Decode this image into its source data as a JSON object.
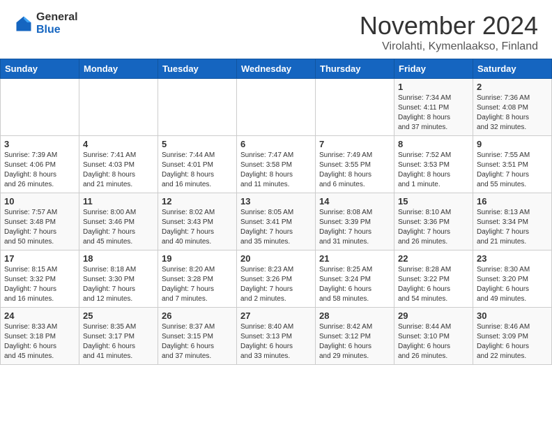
{
  "header": {
    "logo_general": "General",
    "logo_blue": "Blue",
    "month_title": "November 2024",
    "location": "Virolahti, Kymenlaakso, Finland"
  },
  "calendar": {
    "days_of_week": [
      "Sunday",
      "Monday",
      "Tuesday",
      "Wednesday",
      "Thursday",
      "Friday",
      "Saturday"
    ],
    "weeks": [
      [
        {
          "day": "",
          "info": ""
        },
        {
          "day": "",
          "info": ""
        },
        {
          "day": "",
          "info": ""
        },
        {
          "day": "",
          "info": ""
        },
        {
          "day": "",
          "info": ""
        },
        {
          "day": "1",
          "info": "Sunrise: 7:34 AM\nSunset: 4:11 PM\nDaylight: 8 hours\nand 37 minutes."
        },
        {
          "day": "2",
          "info": "Sunrise: 7:36 AM\nSunset: 4:08 PM\nDaylight: 8 hours\nand 32 minutes."
        }
      ],
      [
        {
          "day": "3",
          "info": "Sunrise: 7:39 AM\nSunset: 4:06 PM\nDaylight: 8 hours\nand 26 minutes."
        },
        {
          "day": "4",
          "info": "Sunrise: 7:41 AM\nSunset: 4:03 PM\nDaylight: 8 hours\nand 21 minutes."
        },
        {
          "day": "5",
          "info": "Sunrise: 7:44 AM\nSunset: 4:01 PM\nDaylight: 8 hours\nand 16 minutes."
        },
        {
          "day": "6",
          "info": "Sunrise: 7:47 AM\nSunset: 3:58 PM\nDaylight: 8 hours\nand 11 minutes."
        },
        {
          "day": "7",
          "info": "Sunrise: 7:49 AM\nSunset: 3:55 PM\nDaylight: 8 hours\nand 6 minutes."
        },
        {
          "day": "8",
          "info": "Sunrise: 7:52 AM\nSunset: 3:53 PM\nDaylight: 8 hours\nand 1 minute."
        },
        {
          "day": "9",
          "info": "Sunrise: 7:55 AM\nSunset: 3:51 PM\nDaylight: 7 hours\nand 55 minutes."
        }
      ],
      [
        {
          "day": "10",
          "info": "Sunrise: 7:57 AM\nSunset: 3:48 PM\nDaylight: 7 hours\nand 50 minutes."
        },
        {
          "day": "11",
          "info": "Sunrise: 8:00 AM\nSunset: 3:46 PM\nDaylight: 7 hours\nand 45 minutes."
        },
        {
          "day": "12",
          "info": "Sunrise: 8:02 AM\nSunset: 3:43 PM\nDaylight: 7 hours\nand 40 minutes."
        },
        {
          "day": "13",
          "info": "Sunrise: 8:05 AM\nSunset: 3:41 PM\nDaylight: 7 hours\nand 35 minutes."
        },
        {
          "day": "14",
          "info": "Sunrise: 8:08 AM\nSunset: 3:39 PM\nDaylight: 7 hours\nand 31 minutes."
        },
        {
          "day": "15",
          "info": "Sunrise: 8:10 AM\nSunset: 3:36 PM\nDaylight: 7 hours\nand 26 minutes."
        },
        {
          "day": "16",
          "info": "Sunrise: 8:13 AM\nSunset: 3:34 PM\nDaylight: 7 hours\nand 21 minutes."
        }
      ],
      [
        {
          "day": "17",
          "info": "Sunrise: 8:15 AM\nSunset: 3:32 PM\nDaylight: 7 hours\nand 16 minutes."
        },
        {
          "day": "18",
          "info": "Sunrise: 8:18 AM\nSunset: 3:30 PM\nDaylight: 7 hours\nand 12 minutes."
        },
        {
          "day": "19",
          "info": "Sunrise: 8:20 AM\nSunset: 3:28 PM\nDaylight: 7 hours\nand 7 minutes."
        },
        {
          "day": "20",
          "info": "Sunrise: 8:23 AM\nSunset: 3:26 PM\nDaylight: 7 hours\nand 2 minutes."
        },
        {
          "day": "21",
          "info": "Sunrise: 8:25 AM\nSunset: 3:24 PM\nDaylight: 6 hours\nand 58 minutes."
        },
        {
          "day": "22",
          "info": "Sunrise: 8:28 AM\nSunset: 3:22 PM\nDaylight: 6 hours\nand 54 minutes."
        },
        {
          "day": "23",
          "info": "Sunrise: 8:30 AM\nSunset: 3:20 PM\nDaylight: 6 hours\nand 49 minutes."
        }
      ],
      [
        {
          "day": "24",
          "info": "Sunrise: 8:33 AM\nSunset: 3:18 PM\nDaylight: 6 hours\nand 45 minutes."
        },
        {
          "day": "25",
          "info": "Sunrise: 8:35 AM\nSunset: 3:17 PM\nDaylight: 6 hours\nand 41 minutes."
        },
        {
          "day": "26",
          "info": "Sunrise: 8:37 AM\nSunset: 3:15 PM\nDaylight: 6 hours\nand 37 minutes."
        },
        {
          "day": "27",
          "info": "Sunrise: 8:40 AM\nSunset: 3:13 PM\nDaylight: 6 hours\nand 33 minutes."
        },
        {
          "day": "28",
          "info": "Sunrise: 8:42 AM\nSunset: 3:12 PM\nDaylight: 6 hours\nand 29 minutes."
        },
        {
          "day": "29",
          "info": "Sunrise: 8:44 AM\nSunset: 3:10 PM\nDaylight: 6 hours\nand 26 minutes."
        },
        {
          "day": "30",
          "info": "Sunrise: 8:46 AM\nSunset: 3:09 PM\nDaylight: 6 hours\nand 22 minutes."
        }
      ]
    ]
  }
}
